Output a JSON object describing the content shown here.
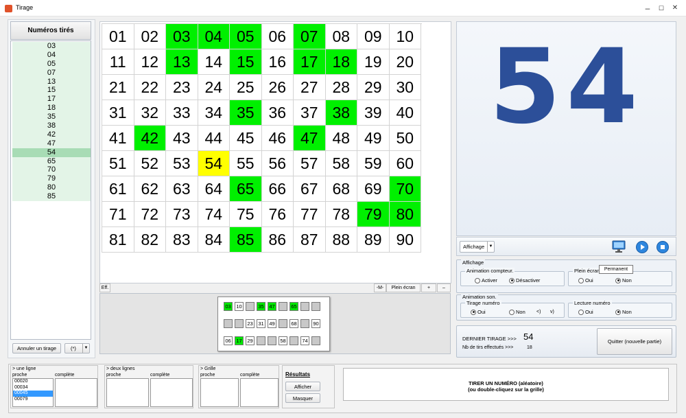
{
  "window": {
    "title": "Tirage",
    "minimize": "–",
    "maximize": "☐",
    "close": "✕"
  },
  "drawn_list": {
    "header": "Numéros tirés",
    "items": [
      "03",
      "04",
      "05",
      "07",
      "13",
      "15",
      "17",
      "18",
      "35",
      "38",
      "42",
      "47",
      "54",
      "65",
      "70",
      "79",
      "80",
      "85"
    ],
    "selected": "54",
    "cancel_button": "Annuler un tirage",
    "option_value": "(*)"
  },
  "grid": {
    "rows": [
      [
        "01",
        "02",
        "03",
        "04",
        "05",
        "06",
        "07",
        "08",
        "09",
        "10"
      ],
      [
        "11",
        "12",
        "13",
        "14",
        "15",
        "16",
        "17",
        "18",
        "19",
        "20"
      ],
      [
        "21",
        "22",
        "23",
        "24",
        "25",
        "26",
        "27",
        "28",
        "29",
        "30"
      ],
      [
        "31",
        "32",
        "33",
        "34",
        "35",
        "36",
        "37",
        "38",
        "39",
        "40"
      ],
      [
        "41",
        "42",
        "43",
        "44",
        "45",
        "46",
        "47",
        "48",
        "49",
        "50"
      ],
      [
        "51",
        "52",
        "53",
        "54",
        "55",
        "56",
        "57",
        "58",
        "59",
        "60"
      ],
      [
        "61",
        "62",
        "63",
        "64",
        "65",
        "66",
        "67",
        "68",
        "69",
        "70"
      ],
      [
        "71",
        "72",
        "73",
        "74",
        "75",
        "76",
        "77",
        "78",
        "79",
        "80"
      ],
      [
        "81",
        "82",
        "83",
        "84",
        "85",
        "86",
        "87",
        "88",
        "89",
        "90"
      ]
    ],
    "drawn": [
      "03",
      "04",
      "05",
      "07",
      "13",
      "15",
      "17",
      "18",
      "35",
      "38",
      "42",
      "47",
      "65",
      "70",
      "79",
      "80",
      "85"
    ],
    "current": "54",
    "drawn_color": "#00f000",
    "current_color": "#ffff00",
    "tools": {
      "clear": "Eff.",
      "m": "-M-",
      "fullscreen": "Plein écran",
      "plus": "+",
      "minus": "–"
    }
  },
  "mini_card": {
    "rows": [
      [
        [
          "03",
          "g"
        ],
        [
          "10",
          ""
        ],
        [
          "",
          "e"
        ],
        [
          "35",
          "g"
        ],
        [
          "47",
          "g"
        ],
        [
          "",
          "e"
        ],
        [
          "65",
          "g"
        ],
        [
          "",
          "e"
        ],
        [
          "",
          "e"
        ]
      ],
      [
        [
          "",
          "e"
        ],
        [
          "",
          "e"
        ],
        [
          "23",
          ""
        ],
        [
          "31",
          ""
        ],
        [
          "49",
          ""
        ],
        [
          "",
          "e"
        ],
        [
          "68",
          ""
        ],
        [
          "",
          "e"
        ],
        [
          "90",
          ""
        ]
      ],
      [
        [
          "06",
          ""
        ],
        [
          "17",
          "g"
        ],
        [
          "29",
          ""
        ],
        [
          "",
          "e"
        ],
        [
          "",
          "e"
        ],
        [
          "58",
          ""
        ],
        [
          "",
          "e"
        ],
        [
          "74",
          ""
        ],
        [
          "",
          "e"
        ]
      ]
    ]
  },
  "display": {
    "big_number": "54",
    "number_color": "#2c4f99",
    "affichage_select": "Affichage",
    "icons": [
      "monitor-icon",
      "play-icon",
      "stop-icon"
    ],
    "tooltip": "Permanent"
  },
  "settings": {
    "affichage_title": "Affichage",
    "animation_compteur": {
      "label": "Animation compteur.",
      "options": [
        "Activer",
        "Désactiver"
      ],
      "selected": "Désactiver"
    },
    "plein_ecran": {
      "label": "Plein écran",
      "options": [
        "Oui",
        "Non"
      ],
      "selected": "Non"
    },
    "animation_son_title": "Animation son.",
    "tirage_numero": {
      "label": "Tirage numéro",
      "options": [
        "Oui",
        "Non"
      ],
      "selected": "Oui",
      "extra": [
        "<)",
        "v)"
      ]
    },
    "lecture_numero": {
      "label": "Lecture numéro",
      "options": [
        "Oui",
        "Non"
      ],
      "selected": "Non"
    }
  },
  "status": {
    "last_label": "DERNIER TIRAGE >>>",
    "last_value": "54",
    "count_label": "Nb de tirs effectués >>>",
    "count_value": "18",
    "quit_button": "Quitter (nouvelle partie)"
  },
  "results": {
    "one_line": {
      "title": "> une ligne",
      "col1": "proche",
      "col2": "complète",
      "items": [
        "00020",
        "00034",
        "00045",
        "00079"
      ],
      "selected": "00045"
    },
    "two_lines": {
      "title": "> deux lignes",
      "col1": "proche",
      "col2": "complète"
    },
    "grid": {
      "title": "> Grille",
      "col1": "proche",
      "col2": "complète"
    },
    "resultats_title": "Résultats",
    "show_button": "Afficher",
    "hide_button": "Masquer",
    "draw_button_line1": "TIRER UN NUMÉRO (aléatoire)",
    "draw_button_line2": "(ou double-cliquez sur la grille)"
  }
}
